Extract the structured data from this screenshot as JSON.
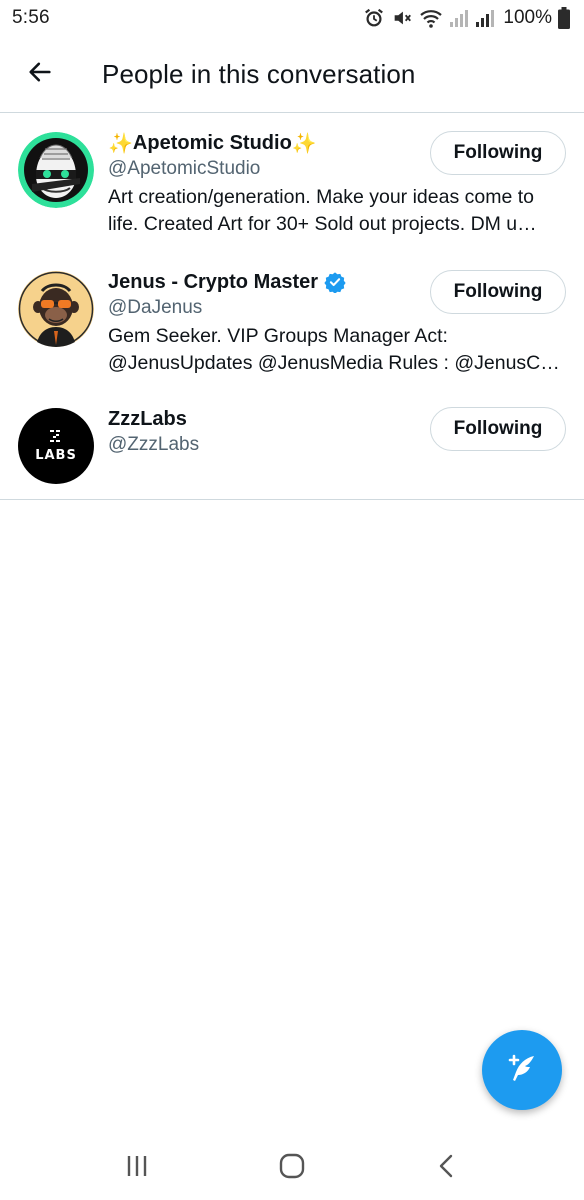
{
  "status_bar": {
    "time": "5:56",
    "battery_percent": "100%",
    "icons": [
      "alarm-icon",
      "mute-icon",
      "wifi-icon",
      "signal-icon",
      "signal-icon",
      "battery-icon"
    ]
  },
  "header": {
    "back_icon": "arrow-left-icon",
    "title": "People in this conversation"
  },
  "people": [
    {
      "name": "Apetomic Studio",
      "name_prefix": "✨",
      "name_suffix": "✨",
      "handle": "@ApetomicStudio",
      "verified": false,
      "bio_lines": [
        "Art creation/generation. Make your ideas come to",
        "life. Created Art for 30+ Sold out projects. DM u…"
      ],
      "button_label": "Following",
      "avatar_bg": "#2ee09a"
    },
    {
      "name": "Jenus - Crypto Master",
      "handle": "@DaJenus",
      "verified": true,
      "bio_lines": [
        "Gem Seeker. VIP Groups Manager  Act:",
        "@JenusUpdates @JenusMedia Rules : @JenusCla…"
      ],
      "button_label": "Following",
      "avatar_bg": "#f6d28c"
    },
    {
      "name": "ZzzLabs",
      "handle": "@ZzzLabs",
      "verified": false,
      "bio_lines": [],
      "button_label": "Following",
      "avatar_bg": "#000000",
      "avatar_text": "LABS"
    }
  ],
  "fab": {
    "icon": "compose-tweet-icon"
  },
  "nav_bar": {
    "icons": [
      "recent-apps-icon",
      "home-icon",
      "back-icon"
    ]
  },
  "colors": {
    "accent": "#1d9bf0",
    "text": "#0f1419",
    "secondary_text": "#536471",
    "border": "#cfd9de"
  }
}
